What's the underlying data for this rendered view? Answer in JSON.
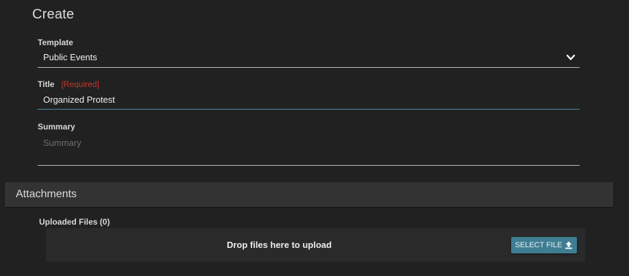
{
  "page": {
    "heading": "Create"
  },
  "form": {
    "template": {
      "label": "Template",
      "value": "Public Events",
      "icon": "chevron-down-icon"
    },
    "title": {
      "label": "Title",
      "required_tag": "[Required]",
      "value": "Organized Protest"
    },
    "summary": {
      "label": "Summary",
      "placeholder": "Summary",
      "value": ""
    }
  },
  "attachments": {
    "heading": "Attachments",
    "uploaded_label": "Uploaded Files (0)",
    "dropzone_text": "Drop files here to upload",
    "select_file_label": "SELECT FILE",
    "select_file_icon": "upload-icon"
  },
  "colors": {
    "background": "#212121",
    "section_bar": "#333333",
    "required": "#c0392b",
    "accent": "#3f7d93",
    "focus_underline": "#4b8ea6"
  }
}
